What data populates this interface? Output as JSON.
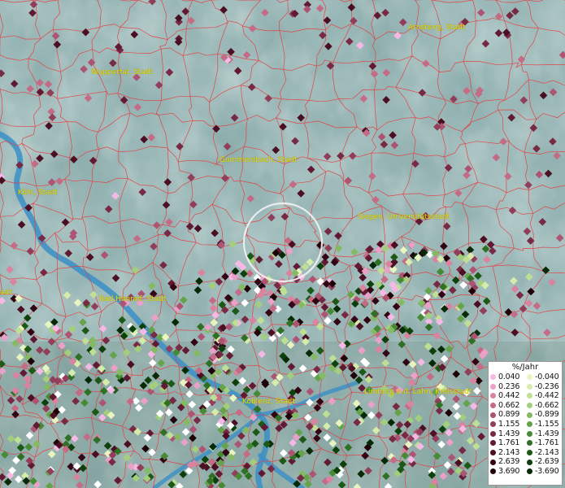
{
  "map": {
    "cities": [
      {
        "name": "Arnsberg, Stadt"
      },
      {
        "name": "Wuppertal, Stadt"
      },
      {
        "name": "Gummersbach, Stadt"
      },
      {
        "name": "Köln, Stadt"
      },
      {
        "name": "Siegen, Universitätsstadt"
      },
      {
        "name": "Bad Honnef, Stadt"
      },
      {
        "name": "Koblenz, Stadt"
      },
      {
        "name": "Limburg a.d. Lahn, Kreisstadt"
      },
      {
        "name": "adt"
      }
    ],
    "colors": {
      "terrain": "#8fb0ad",
      "river": "#3a8fc7",
      "boundaries": "#e8393c",
      "city_label": "#e8e000",
      "marker_ring": "#f2f2f2"
    }
  },
  "legend": {
    "title": "%/Jahr",
    "positive": [
      {
        "value": "0.040",
        "color": "#f6b8e4"
      },
      {
        "value": "0.236",
        "color": "#eaa0c8"
      },
      {
        "value": "0.442",
        "color": "#d9839f"
      },
      {
        "value": "0.662",
        "color": "#c46c86"
      },
      {
        "value": "0.899",
        "color": "#ac5472"
      },
      {
        "value": "1.155",
        "color": "#913e5a"
      },
      {
        "value": "1.439",
        "color": "#782a44"
      },
      {
        "value": "1.761",
        "color": "#621a32"
      },
      {
        "value": "2.143",
        "color": "#4b0e22"
      },
      {
        "value": "2.639",
        "color": "#330514"
      },
      {
        "value": "3.690",
        "color": "#1f0208"
      }
    ],
    "negative": [
      {
        "value": "-0.040",
        "color": "#e9f5c0"
      },
      {
        "value": "-0.236",
        "color": "#d6ecaa"
      },
      {
        "value": "-0.442",
        "color": "#bfe094"
      },
      {
        "value": "-0.662",
        "color": "#a3cf7c"
      },
      {
        "value": "-0.899",
        "color": "#84bb62"
      },
      {
        "value": "-1.155",
        "color": "#64a34a"
      },
      {
        "value": "-1.439",
        "color": "#478a36"
      },
      {
        "value": "-1.761",
        "color": "#2f7024"
      },
      {
        "value": "-2.143",
        "color": "#1c5816"
      },
      {
        "value": "-2.639",
        "color": "#0e400c"
      },
      {
        "value": "-3.690",
        "color": "#062a06"
      }
    ]
  }
}
